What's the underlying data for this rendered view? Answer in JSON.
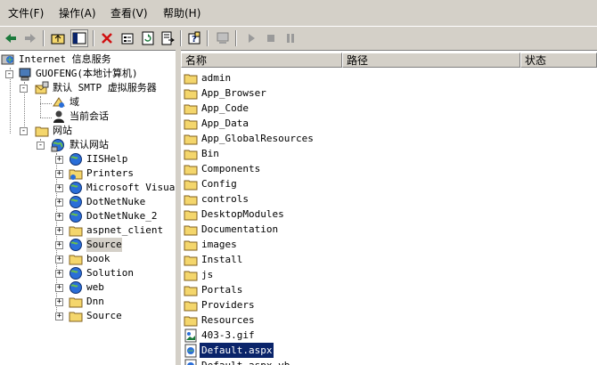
{
  "menu": {
    "file": "文件(F)",
    "action": "操作(A)",
    "view": "查看(V)",
    "help": "帮助(H)"
  },
  "toolbar": [
    "back-icon",
    "forward-icon",
    "up-folder-icon",
    "show-tree-icon",
    "delete-icon",
    "properties-icon",
    "refresh-icon",
    "export-list-icon",
    "help-icon",
    "computer-icon",
    "start-icon",
    "stop-icon",
    "pause-icon"
  ],
  "tree": {
    "root": "Internet 信息服务",
    "computer": "GUOFENG(本地计算机)",
    "smtp": "默认 SMTP 虚拟服务器",
    "domain": "域",
    "sessions": "当前会话",
    "websites": "网站",
    "default_site": "默认网站",
    "children": [
      "IISHelp",
      "Printers",
      "Microsoft Visual",
      "DotNetNuke",
      "DotNetNuke_2",
      "aspnet_client",
      "Source",
      "book",
      "Solution",
      "web",
      "Dnn",
      "Source"
    ]
  },
  "list": {
    "columns": [
      "名称",
      "路径",
      "状态"
    ],
    "items": [
      {
        "name": "admin",
        "type": "folder"
      },
      {
        "name": "App_Browser",
        "type": "folder"
      },
      {
        "name": "App_Code",
        "type": "folder"
      },
      {
        "name": "App_Data",
        "type": "folder"
      },
      {
        "name": "App_GlobalResources",
        "type": "folder"
      },
      {
        "name": "Bin",
        "type": "folder"
      },
      {
        "name": "Components",
        "type": "folder"
      },
      {
        "name": "Config",
        "type": "folder"
      },
      {
        "name": "controls",
        "type": "folder"
      },
      {
        "name": "DesktopModules",
        "type": "folder"
      },
      {
        "name": "Documentation",
        "type": "folder"
      },
      {
        "name": "images",
        "type": "folder"
      },
      {
        "name": "Install",
        "type": "folder"
      },
      {
        "name": "js",
        "type": "folder"
      },
      {
        "name": "Portals",
        "type": "folder"
      },
      {
        "name": "Providers",
        "type": "folder"
      },
      {
        "name": "Resources",
        "type": "folder"
      },
      {
        "name": "403-3.gif",
        "type": "image"
      },
      {
        "name": "Default.aspx",
        "type": "aspx",
        "selected": true
      },
      {
        "name": "Default.aspx.vb",
        "type": "aspx"
      }
    ]
  },
  "colors": {
    "selection": "#0a246a",
    "folder": "#f4d66c",
    "window": "#d4d0c8"
  }
}
